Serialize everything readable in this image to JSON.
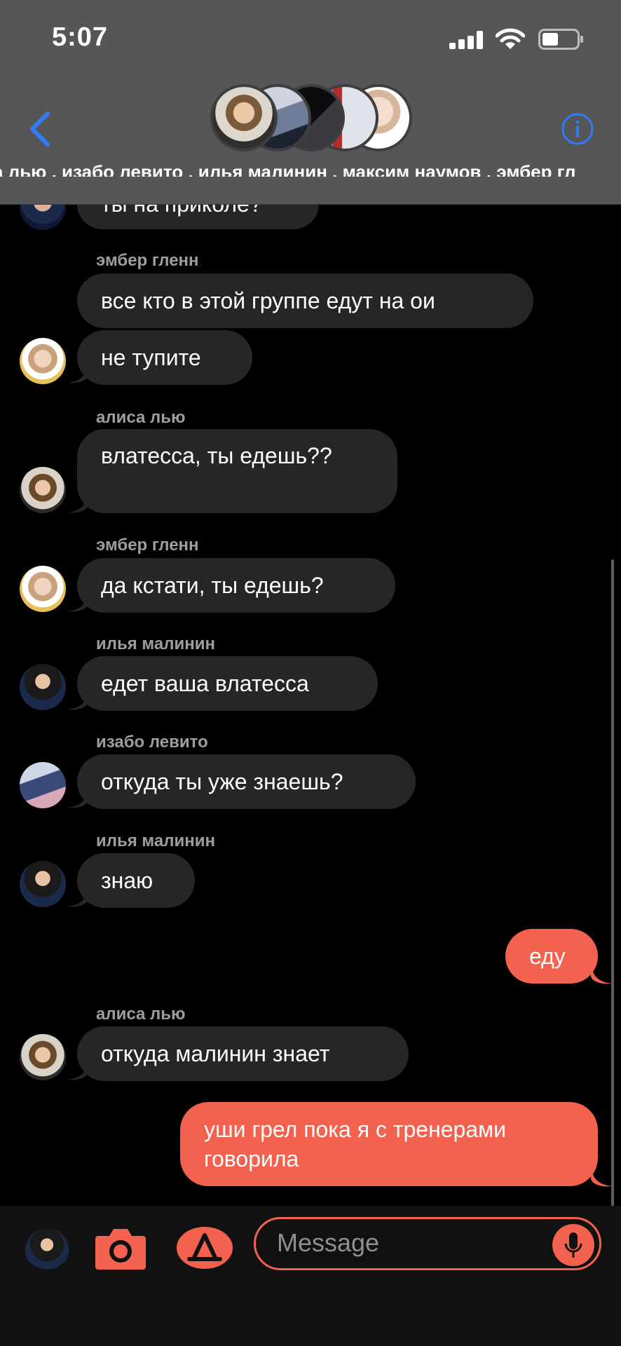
{
  "status_bar": {
    "time": "5:07"
  },
  "header": {
    "participants_line": "а лью , изабо левито , илья малинин , максим наумов , эмбер гл"
  },
  "messages": [
    {
      "sender": "",
      "text": "ты на приколе?",
      "from_me": false
    },
    {
      "sender": "эмбер гленн",
      "text": "все кто в этой группе едут на ои",
      "from_me": false
    },
    {
      "sender": "",
      "text": "не тупите",
      "from_me": false
    },
    {
      "sender": "алиса лью",
      "text": "влатесса, ты едешь??",
      "from_me": false
    },
    {
      "sender": "эмбер гленн",
      "text": "да кстати, ты едешь?",
      "from_me": false
    },
    {
      "sender": "илья малинин",
      "text": "едет ваша влатесса",
      "from_me": false
    },
    {
      "sender": "изабо левито",
      "text": "откуда ты уже знаешь?",
      "from_me": false
    },
    {
      "sender": "илья малинин",
      "text": "знаю",
      "from_me": false
    },
    {
      "sender": "",
      "text": "еду",
      "from_me": true
    },
    {
      "sender": "алиса лью",
      "text": "откуда малинин знает",
      "from_me": false
    },
    {
      "sender": "",
      "text": "уши грел пока я с тренерами говорила",
      "from_me": true
    }
  ],
  "composer": {
    "placeholder": "Message",
    "icons": [
      "avatar-icon",
      "camera-icon",
      "app-store-icon",
      "microphone-icon"
    ]
  },
  "colors": {
    "accent": "#f2624e",
    "header_bg": "#565659",
    "incoming_bubble": "#262628",
    "link_blue": "#2f7cf6"
  }
}
